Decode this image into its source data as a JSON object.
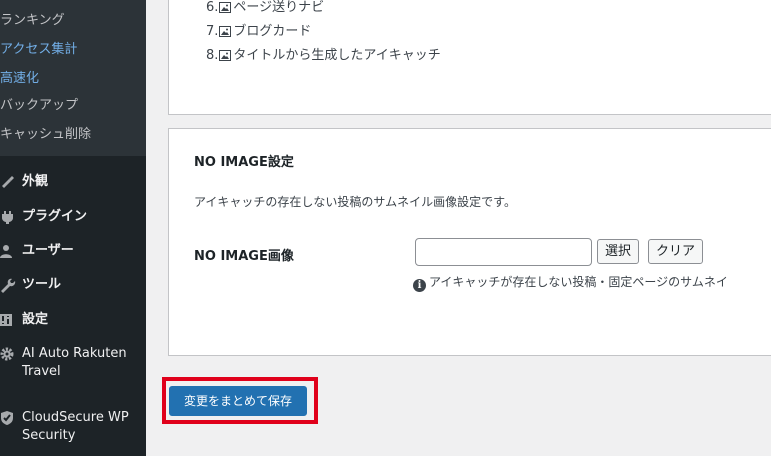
{
  "sidebar": {
    "submenu": [
      {
        "label": "ランキング",
        "active": false
      },
      {
        "label": "アクセス集計",
        "active": true
      },
      {
        "label": "高速化",
        "active": true
      },
      {
        "label": "バックアップ",
        "active": false
      },
      {
        "label": "キャッシュ削除",
        "active": false
      }
    ],
    "menu": [
      {
        "label": "外観",
        "icon": "brush-icon"
      },
      {
        "label": "プラグイン",
        "icon": "plugin-icon"
      },
      {
        "label": "ユーザー",
        "icon": "user-icon"
      },
      {
        "label": "ツール",
        "icon": "wrench-icon"
      },
      {
        "label": "設定",
        "icon": "settings-icon"
      },
      {
        "label": "AI Auto Rakuten Travel",
        "icon": "gear-icon"
      },
      {
        "label": "CloudSecure WP Security",
        "icon": "shield-icon"
      }
    ]
  },
  "top_list": [
    {
      "num": "6.",
      "label": "ページ送りナビ"
    },
    {
      "num": "7.",
      "label": "ブログカード"
    },
    {
      "num": "8.",
      "label": "タイトルから生成したアイキャッチ"
    }
  ],
  "noimage": {
    "title": "NO IMAGE設定",
    "description": "アイキャッチの存在しない投稿のサムネイル画像設定です。",
    "field_label": "NO IMAGE画像",
    "input_value": "",
    "select_button": "選択",
    "clear_button": "クリア",
    "info_text": "アイキャッチが存在しない投稿・固定ページのサムネイ"
  },
  "save_button": "変更をまとめて保存",
  "colors": {
    "sidebar_bg": "#1d2327",
    "submenu_bg": "#2c3338",
    "active_link": "#72aee6",
    "primary": "#2271b1",
    "highlight": "#e0001b"
  }
}
